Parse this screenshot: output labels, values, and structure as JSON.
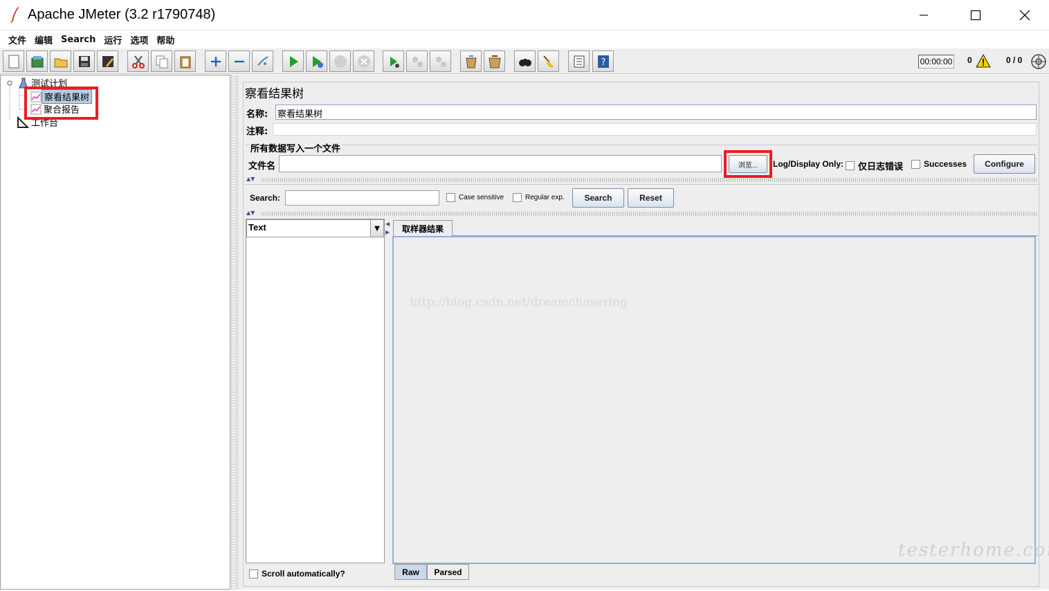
{
  "window": {
    "title": "Apache JMeter (3.2 r1790748)",
    "controls": {
      "minimize": "—",
      "maximize": "☐",
      "close": "✕"
    }
  },
  "menu": [
    "文件",
    "编辑",
    "Search",
    "运行",
    "选项",
    "帮助"
  ],
  "toolbar": {
    "icons": [
      "new-icon",
      "templates-icon",
      "open-icon",
      "save-icon",
      "save-as-icon",
      "cut-icon",
      "copy-icon",
      "paste-icon",
      "expand-icon",
      "collapse-icon",
      "toggle-icon",
      "start-icon",
      "start-no-timers-icon",
      "stop-icon",
      "shutdown-icon",
      "remote-start-icon",
      "remote-stop-icon",
      "remote-exit-icon",
      "clear-icon",
      "clear-all-icon",
      "search-icon",
      "reset-search-icon",
      "function-helper-icon",
      "help-icon"
    ],
    "timer": "00:00:00",
    "error_count": "0",
    "thread_count": "0 / 0"
  },
  "tree": {
    "root": "测试计划",
    "children": [
      "察看结果树",
      "聚合报告"
    ],
    "workbench": "工作台"
  },
  "panel": {
    "title": "察看结果树",
    "name_label": "名称:",
    "name_value": "察看结果树",
    "comment_label": "注释:",
    "comment_value": "",
    "file_section": "所有数据写入一个文件",
    "filename_label": "文件名",
    "filename_value": "",
    "browse_button": "浏览...",
    "log_display_label": "Log/Display Only:",
    "errors_only_label": "仅日志错误",
    "successes_label": "Successes",
    "configure_button": "Configure"
  },
  "search": {
    "label": "Search:",
    "value": "",
    "case_sensitive": "Case sensitive",
    "regex": "Regular exp.",
    "search_button": "Search",
    "reset_button": "Reset"
  },
  "results": {
    "renderer": "Text",
    "tab_label": "取样器结果",
    "scroll_label": "Scroll automatically?",
    "subtabs": [
      "Raw",
      "Parsed"
    ],
    "watermark": "http://blog.csdn.net/dreamchasering",
    "corner_mark": "testerhome.com"
  },
  "colors": {
    "highlight": "#ec1c24",
    "selection": "#b8cfe5",
    "panel_bg": "#eeeeee"
  }
}
